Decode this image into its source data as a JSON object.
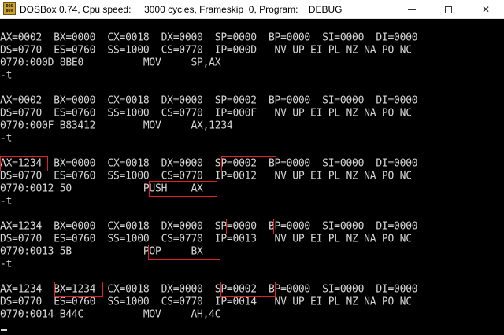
{
  "window": {
    "title": "DOSBox 0.74, Cpu speed:     3000 cycles, Frameskip  0, Program:    DEBUG",
    "icon": "dosbox-icon",
    "icon_text": "DOS\nBOX"
  },
  "console": {
    "lines": [
      "AX=0002  BX=0000  CX=0018  DX=0000  SP=0000  BP=0000  SI=0000  DI=0000",
      "DS=0770  ES=0760  SS=1000  CS=0770  IP=000D   NV UP EI PL NZ NA PO NC",
      "0770:000D 8BE0          MOV     SP,AX",
      "-t",
      "",
      "AX=0002  BX=0000  CX=0018  DX=0000  SP=0002  BP=0000  SI=0000  DI=0000",
      "DS=0770  ES=0760  SS=1000  CS=0770  IP=000F   NV UP EI PL NZ NA PO NC",
      "0770:000F B83412        MOV     AX,1234",
      "-t",
      "",
      "AX=1234  BX=0000  CX=0018  DX=0000  SP=0002  BP=0000  SI=0000  DI=0000",
      "DS=0770  ES=0760  SS=1000  CS=0770  IP=0012   NV UP EI PL NZ NA PO NC",
      "0770:0012 50            PUSH    AX",
      "-t",
      "",
      "AX=1234  BX=0000  CX=0018  DX=0000  SP=0000  BP=0000  SI=0000  DI=0000",
      "DS=0770  ES=0760  SS=1000  CS=0770  IP=0013   NV UP EI PL NZ NA PO NC",
      "0770:0013 5B            POP     BX",
      "-t",
      "",
      "AX=1234  BX=1234  CX=0018  DX=0000  SP=0002  BP=0000  SI=0000  DI=0000",
      "DS=0770  ES=0760  SS=1000  CS=0770  IP=0014   NV UP EI PL NZ NA PO NC",
      "0770:0014 B44C          MOV     AH,4C"
    ]
  },
  "colors": {
    "console_bg": "#000000",
    "console_text": "#d6d6d6",
    "highlight_border": "#e02020",
    "titlebar_bg": "#ffffff"
  }
}
